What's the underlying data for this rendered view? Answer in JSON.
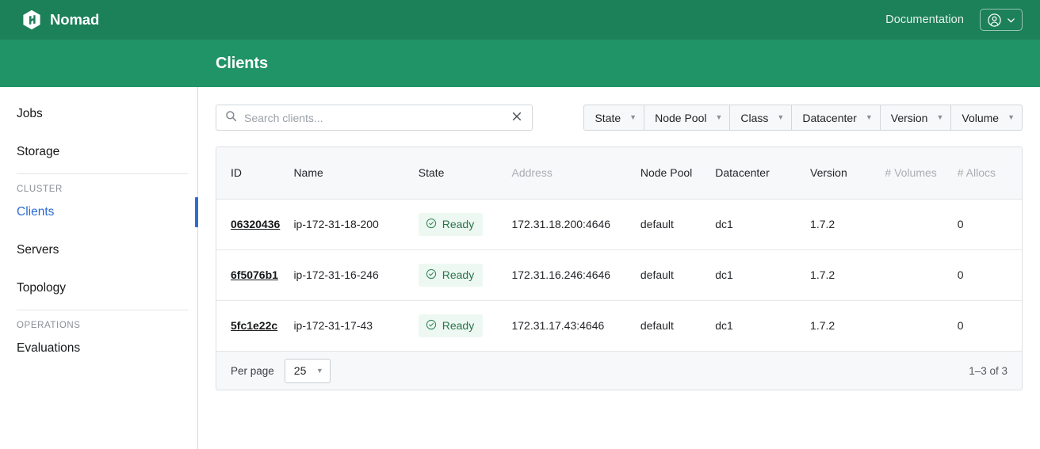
{
  "topnav": {
    "brand": "Nomad",
    "logo_icon": "nomad-hexagon-logo",
    "documentation_label": "Documentation",
    "user_icon": "user-circle-icon",
    "chevron_icon": "chevron-down-icon",
    "background_color": "#1c8059"
  },
  "subheader": {
    "title": "Clients",
    "background_color": "#219467"
  },
  "sidebar": {
    "items": [
      {
        "label": "Jobs",
        "active": false
      },
      {
        "label": "Storage",
        "active": false
      }
    ],
    "sections": [
      {
        "label": "CLUSTER",
        "items": [
          {
            "label": "Clients",
            "active": true
          },
          {
            "label": "Servers",
            "active": false
          },
          {
            "label": "Topology",
            "active": false
          }
        ]
      },
      {
        "label": "OPERATIONS",
        "items": [
          {
            "label": "Evaluations",
            "active": false
          }
        ]
      }
    ],
    "active_color": "#2d6ecf"
  },
  "toolbar": {
    "search": {
      "icon": "search-icon",
      "placeholder": "Search clients...",
      "value": "",
      "clear_icon": "close-icon"
    },
    "filters": [
      {
        "label": "State"
      },
      {
        "label": "Node Pool"
      },
      {
        "label": "Class"
      },
      {
        "label": "Datacenter"
      },
      {
        "label": "Version"
      },
      {
        "label": "Volume"
      }
    ],
    "caret_glyph": "▼"
  },
  "table": {
    "columns": [
      {
        "label": "ID",
        "muted": false
      },
      {
        "label": "Name",
        "muted": false
      },
      {
        "label": "State",
        "muted": false
      },
      {
        "label": "Address",
        "muted": true
      },
      {
        "label": "Node Pool",
        "muted": false
      },
      {
        "label": "Datacenter",
        "muted": false
      },
      {
        "label": "Version",
        "muted": false
      },
      {
        "label": "# Volumes",
        "muted": true
      },
      {
        "label": "# Allocs",
        "muted": true
      }
    ],
    "rows": [
      {
        "id": "06320436",
        "name": "ip-172-31-18-200",
        "state": "Ready",
        "state_icon": "check-circle-icon",
        "address": "172.31.18.200:4646",
        "node_pool": "default",
        "datacenter": "dc1",
        "version": "1.7.2",
        "volumes": "",
        "allocs": "0"
      },
      {
        "id": "6f5076b1",
        "name": "ip-172-31-16-246",
        "state": "Ready",
        "state_icon": "check-circle-icon",
        "address": "172.31.16.246:4646",
        "node_pool": "default",
        "datacenter": "dc1",
        "version": "1.7.2",
        "volumes": "",
        "allocs": "0"
      },
      {
        "id": "5fc1e22c",
        "name": "ip-172-31-17-43",
        "state": "Ready",
        "state_icon": "check-circle-icon",
        "address": "172.31.17.43:4646",
        "node_pool": "default",
        "datacenter": "dc1",
        "version": "1.7.2",
        "volumes": "",
        "allocs": "0"
      }
    ],
    "state_badge_color": "#2a724b",
    "state_badge_background": "#eef8f2"
  },
  "footer": {
    "per_page_label": "Per page",
    "per_page_value": "25",
    "per_page_caret": "▼",
    "range_text": "1–3 of 3"
  }
}
